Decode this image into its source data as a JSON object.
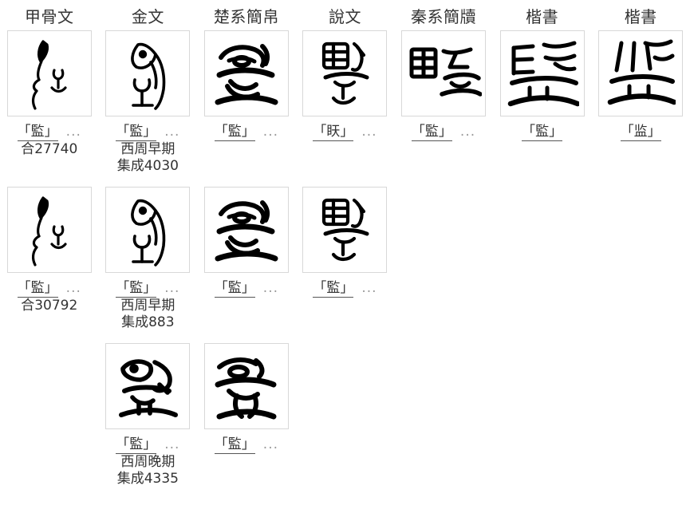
{
  "table": {
    "headers": [
      "甲骨文",
      "金文",
      "楚系簡帛",
      "說文",
      "秦系簡牘",
      "楷書",
      "楷書"
    ],
    "rows": [
      {
        "cells": [
          {
            "glyph_kind": "oracle-bone",
            "glyph_label": "監",
            "caption_char": "「監」",
            "caption_ellipsis": "...",
            "source_lines": [
              "合27740"
            ]
          },
          {
            "glyph_kind": "bronze",
            "glyph_label": "監",
            "caption_char": "「監」",
            "caption_ellipsis": "...",
            "source_lines": [
              "西周早期",
              "集成4030"
            ]
          },
          {
            "glyph_kind": "chu-bamboo",
            "glyph_label": "監",
            "caption_char": "「監」",
            "caption_ellipsis": "...",
            "source_lines": []
          },
          {
            "glyph_kind": "seal-shuowen",
            "glyph_label": "䀖",
            "caption_char": "「䀖」",
            "caption_ellipsis": "...",
            "source_lines": []
          },
          {
            "glyph_kind": "qin-slip",
            "glyph_label": "監",
            "caption_char": "「監」",
            "caption_ellipsis": "...",
            "source_lines": []
          },
          {
            "glyph_kind": "regular-traditional",
            "glyph_label": "監",
            "caption_char": "「監」",
            "caption_ellipsis": "",
            "source_lines": []
          },
          {
            "glyph_kind": "regular-simplified",
            "glyph_label": "监",
            "caption_char": "「监」",
            "caption_ellipsis": "",
            "source_lines": []
          }
        ]
      },
      {
        "cells": [
          {
            "glyph_kind": "oracle-bone",
            "glyph_label": "監",
            "caption_char": "「監」",
            "caption_ellipsis": "...",
            "source_lines": [
              "合30792"
            ]
          },
          {
            "glyph_kind": "bronze",
            "glyph_label": "監",
            "caption_char": "「監」",
            "caption_ellipsis": "...",
            "source_lines": [
              "西周早期",
              "集成883"
            ]
          },
          {
            "glyph_kind": "chu-bamboo",
            "glyph_label": "監",
            "caption_char": "「監」",
            "caption_ellipsis": "...",
            "source_lines": []
          },
          {
            "glyph_kind": "seal-shuowen",
            "glyph_label": "監",
            "caption_char": "「監」",
            "caption_ellipsis": "...",
            "source_lines": []
          },
          {
            "glyph_kind": "none",
            "glyph_label": "",
            "caption_char": "",
            "caption_ellipsis": "",
            "source_lines": []
          },
          {
            "glyph_kind": "none",
            "glyph_label": "",
            "caption_char": "",
            "caption_ellipsis": "",
            "source_lines": []
          },
          {
            "glyph_kind": "none",
            "glyph_label": "",
            "caption_char": "",
            "caption_ellipsis": "",
            "source_lines": []
          }
        ]
      },
      {
        "cells": [
          {
            "glyph_kind": "none",
            "glyph_label": "",
            "caption_char": "",
            "caption_ellipsis": "",
            "source_lines": []
          },
          {
            "glyph_kind": "bronze-late",
            "glyph_label": "監",
            "caption_char": "「監」",
            "caption_ellipsis": "...",
            "source_lines": [
              "西周晚期",
              "集成4335"
            ]
          },
          {
            "glyph_kind": "chu-bamboo-2",
            "glyph_label": "監",
            "caption_char": "「監」",
            "caption_ellipsis": "...",
            "source_lines": []
          },
          {
            "glyph_kind": "none",
            "glyph_label": "",
            "caption_char": "",
            "caption_ellipsis": "",
            "source_lines": []
          },
          {
            "glyph_kind": "none",
            "glyph_label": "",
            "caption_char": "",
            "caption_ellipsis": "",
            "source_lines": []
          },
          {
            "glyph_kind": "none",
            "glyph_label": "",
            "caption_char": "",
            "caption_ellipsis": "",
            "source_lines": []
          },
          {
            "glyph_kind": "none",
            "glyph_label": "",
            "caption_char": "",
            "caption_ellipsis": "",
            "source_lines": []
          }
        ]
      }
    ]
  },
  "colors": {
    "text": "#333333",
    "muted": "#9a9a9a",
    "cell_border": "#d8d8d8",
    "glyph_ink": "#000000",
    "background": "#ffffff"
  }
}
